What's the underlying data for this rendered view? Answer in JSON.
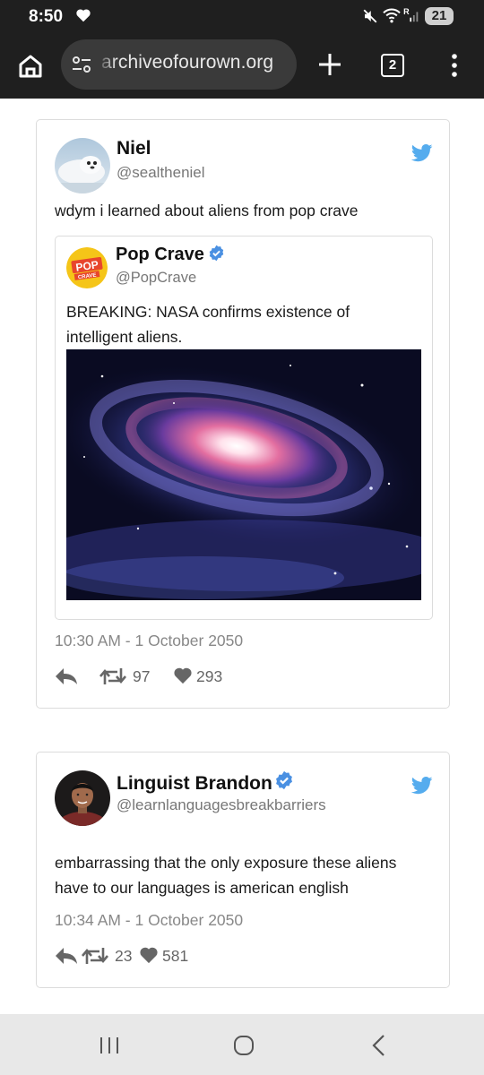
{
  "status_bar": {
    "time": "8:50",
    "signal_label": "R",
    "battery": "21"
  },
  "browser": {
    "url": "archiveofourown.org",
    "tab_count": "2"
  },
  "tweets": [
    {
      "name": "Niel",
      "handle": "@sealtheniel",
      "text": "wdym i learned about aliens from pop crave",
      "verified": false,
      "quote": {
        "avatar_text_1": "POP",
        "avatar_text_2": "CRAVE",
        "name": "Pop Crave",
        "handle": "@PopCrave",
        "verified": true,
        "text": "BREAKING: NASA confirms existence of intelligent aliens."
      },
      "timestamp": "10:30 AM - 1 October 2050",
      "retweets": "97",
      "likes": "293"
    },
    {
      "name": "Linguist Brandon",
      "handle": "@learnlanguagesbreakbarriers",
      "verified": true,
      "text": "embarrassing that the only exposure these aliens have to our languages is american english",
      "timestamp": "10:34 AM - 1 October 2050",
      "retweets": "23",
      "likes": "581"
    }
  ],
  "colors": {
    "twitter_blue": "#55acee",
    "verified_blue": "#4a90e2",
    "bars": "#1f1f1f",
    "popcrave_yellow": "#f5c518",
    "popcrave_red": "#e8452c"
  }
}
